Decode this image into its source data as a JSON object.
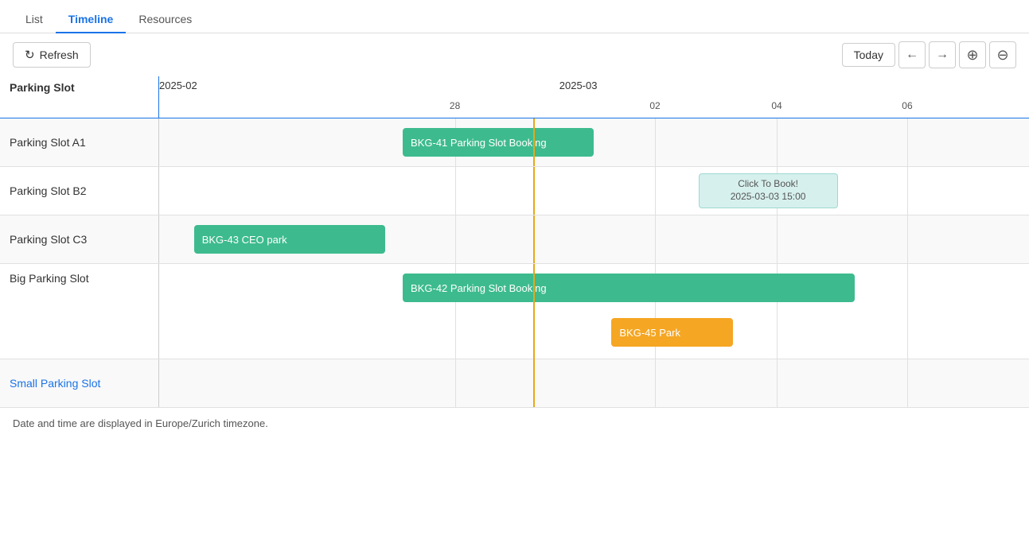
{
  "nav": {
    "tabs": [
      {
        "id": "list",
        "label": "List",
        "active": false
      },
      {
        "id": "timeline",
        "label": "Timeline",
        "active": true
      },
      {
        "id": "resources",
        "label": "Resources",
        "active": false
      }
    ]
  },
  "toolbar": {
    "refresh_label": "Refresh",
    "today_label": "Today",
    "prev_icon": "←",
    "next_icon": "→",
    "zoom_in_icon": "⊕",
    "zoom_out_icon": "⊖"
  },
  "gantt": {
    "column_header": "Parking Slot",
    "months": [
      {
        "label": "2025-02",
        "left_pct": 0
      },
      {
        "label": "2025-03",
        "left_pct": 46
      }
    ],
    "days": [
      {
        "label": "28",
        "left_pct": 34
      },
      {
        "label": "02",
        "left_pct": 57
      },
      {
        "label": "04",
        "left_pct": 71
      },
      {
        "label": "06",
        "left_pct": 86
      }
    ],
    "current_time_pct": 43,
    "rows": [
      {
        "id": "slot-a1",
        "label": "Parking Slot A1",
        "linked": false,
        "bars": [
          {
            "id": "bkg41",
            "label": "BKG-41 Parking Slot Booking",
            "left_pct": 28,
            "width_pct": 22,
            "type": "green"
          }
        ]
      },
      {
        "id": "slot-b2",
        "label": "Parking Slot B2",
        "linked": false,
        "bars": [
          {
            "id": "click-book",
            "label": "Click To Book!\n2025-03-03 15:00",
            "left_pct": 62,
            "width_pct": 15,
            "type": "light"
          }
        ]
      },
      {
        "id": "slot-c3",
        "label": "Parking Slot C3",
        "linked": false,
        "bars": [
          {
            "id": "bkg43",
            "label": "BKG-43 CEO park",
            "left_pct": 4,
            "width_pct": 22,
            "type": "green"
          }
        ]
      },
      {
        "id": "big-slot",
        "label": "Big Parking Slot",
        "linked": false,
        "bars": [
          {
            "id": "bkg42",
            "label": "BKG-42 Parking Slot Booking",
            "left_pct": 28,
            "width_pct": 52,
            "type": "green"
          },
          {
            "id": "bkg45",
            "label": "BKG-45 Park",
            "left_pct": 52,
            "width_pct": 14,
            "type": "orange"
          }
        ]
      },
      {
        "id": "small-slot",
        "label": "Small Parking Slot",
        "linked": true,
        "bars": []
      }
    ]
  },
  "footnote": "Date and time are displayed in Europe/Zurich timezone."
}
